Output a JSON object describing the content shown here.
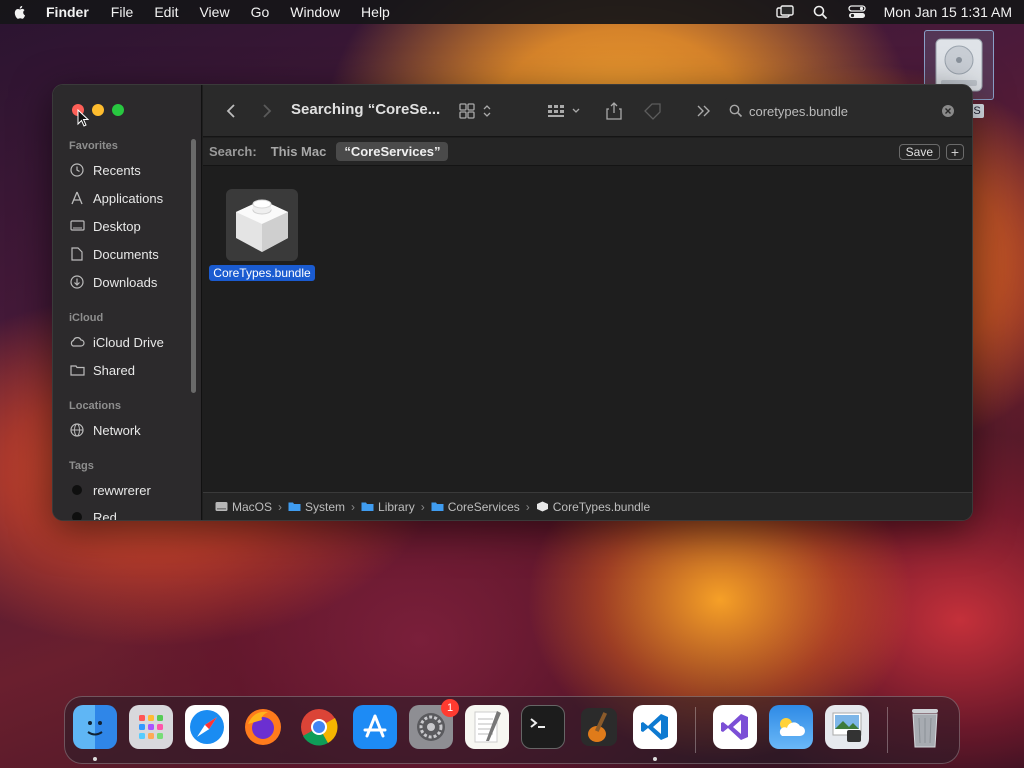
{
  "menubar": {
    "app_name": "Finder",
    "items": [
      "File",
      "Edit",
      "View",
      "Go",
      "Window",
      "Help"
    ],
    "datetime": "Mon Jan 15  1:31 AM",
    "right_icons": [
      "screen-mirroring-icon",
      "spotlight-search-icon",
      "control-center-icon"
    ]
  },
  "desktop": {
    "disk_label": "S"
  },
  "finder": {
    "title": "Searching “CoreSe...",
    "search_value": "coretypes.bundle",
    "sidebar": {
      "favorites_label": "Favorites",
      "favorites": [
        {
          "label": "Recents",
          "icon": "clock-icon"
        },
        {
          "label": "Applications",
          "icon": "applications-icon"
        },
        {
          "label": "Desktop",
          "icon": "desktop-icon"
        },
        {
          "label": "Documents",
          "icon": "document-icon"
        },
        {
          "label": "Downloads",
          "icon": "download-icon"
        }
      ],
      "icloud_label": "iCloud",
      "icloud": [
        {
          "label": "iCloud Drive",
          "icon": "cloud-icon"
        },
        {
          "label": "Shared",
          "icon": "shared-folder-icon"
        }
      ],
      "locations_label": "Locations",
      "locations": [
        {
          "label": "Network",
          "icon": "globe-icon"
        }
      ],
      "tags_label": "Tags",
      "tags": [
        {
          "label": "rewwrerer",
          "color": "#1a1a1a"
        },
        {
          "label": "Red",
          "color": "#1a1a1a"
        }
      ]
    },
    "scope": {
      "label": "Search:",
      "this_mac": "This Mac",
      "selected": "“CoreServices”",
      "save_label": "Save",
      "plus_label": "+"
    },
    "file": {
      "name": "CoreTypes.bundle"
    },
    "path": [
      "MacOS",
      "System",
      "Library",
      "CoreServices",
      "CoreTypes.bundle"
    ]
  },
  "dock": {
    "apps": [
      "Finder",
      "Launchpad",
      "Safari",
      "Firefox",
      "Chrome",
      "App Store",
      "System Settings",
      "TextEdit",
      "Terminal",
      "GarageBand",
      "Visual Studio Code",
      "Visual Studio",
      "Weather",
      "Preview",
      "Trash"
    ],
    "settings_badge": "1"
  },
  "colors": {
    "accent": "#1a5bd0",
    "close": "#fe5f57",
    "minimize": "#febc2e",
    "maximize": "#28c840"
  }
}
